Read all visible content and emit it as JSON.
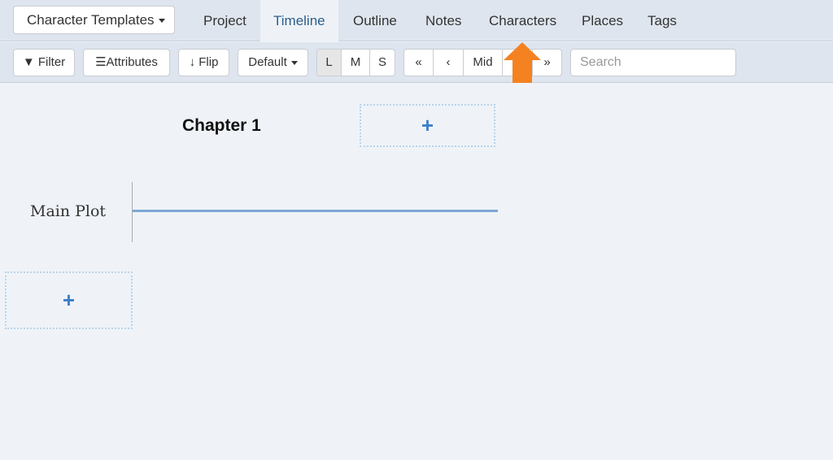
{
  "nav": {
    "template_button": "Character Templates",
    "tabs": [
      "Project",
      "Timeline",
      "Outline",
      "Notes",
      "Characters",
      "Places",
      "Tags"
    ],
    "active_tab": "Timeline"
  },
  "toolbar": {
    "filter": "Filter",
    "attributes": "Attributes",
    "flip": "Flip",
    "default": "Default",
    "sizes": [
      "L",
      "M",
      "S"
    ],
    "active_size": "L",
    "nav_first": "«",
    "nav_prev": "‹",
    "nav_mid": "Mid",
    "nav_next": "›",
    "nav_last": "»",
    "search_placeholder": "Search"
  },
  "timeline": {
    "chapter": "Chapter 1",
    "plotline": "Main Plot",
    "add_symbol": "+"
  },
  "annotation": {
    "arrow_color": "#f58220",
    "icon": "arrow-up-icon"
  }
}
